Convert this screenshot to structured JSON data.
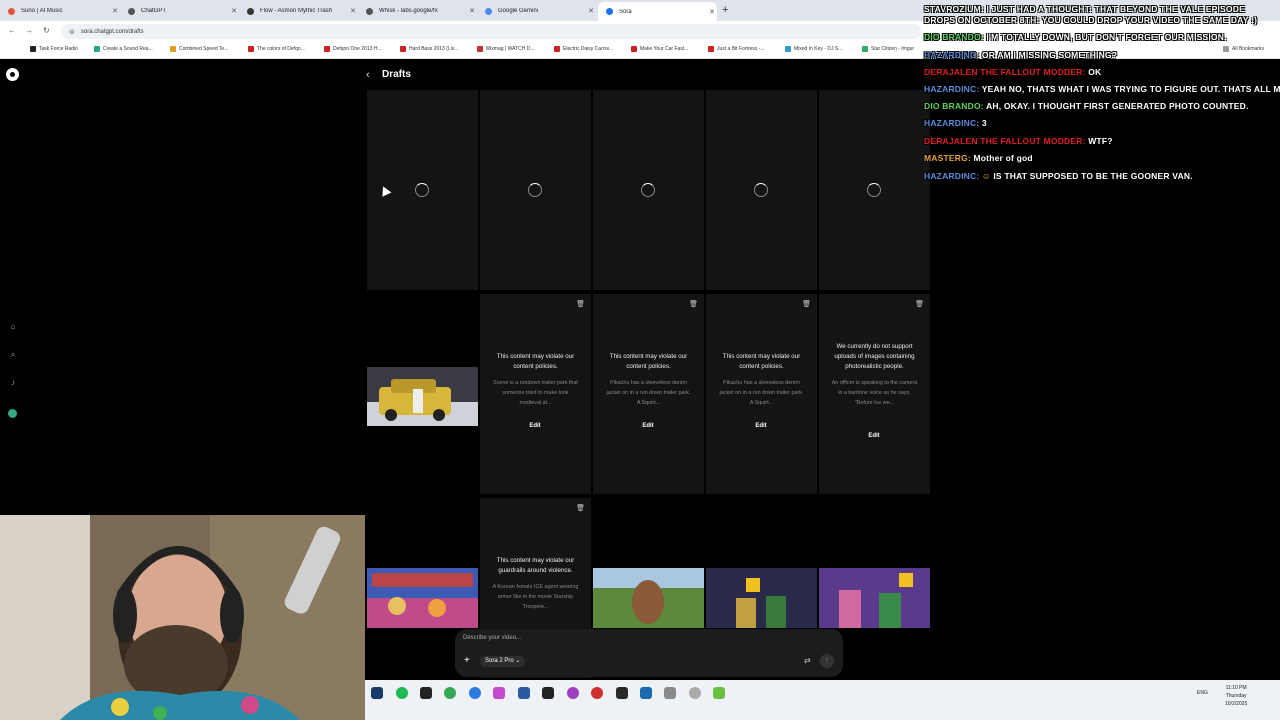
{
  "browser": {
    "tabs": [
      {
        "label": "Suno | AI Music",
        "color": "#e8553a"
      },
      {
        "label": "ChatGPT",
        "color": "#555555"
      },
      {
        "label": "Flow - Asmon Mythic Trash",
        "color": "#333333"
      },
      {
        "label": "Whisk - labs.google/fx",
        "color": "#555555"
      },
      {
        "label": "Google Gemini",
        "color": "#4a8af4"
      },
      {
        "label": "Sora",
        "color": "#1a73e8"
      }
    ],
    "url": "sora.chatgpt.com/drafts",
    "bookmarks": [
      "Task Force Radio",
      "Create a Sound Rea...",
      "Combined Speed Te...",
      "The colors of Defqo...",
      "Defqon One 2013 H...",
      "Hard Bass 2013 (Liv...",
      "Mixmag | WATCH D...",
      "Electric Daisy Carniv...",
      "Make Your Car Fast...",
      "Just a Bit Fortress -...",
      "Mixed In Key - DJ S...",
      "Star Citizen - Imgur"
    ],
    "all_bookmarks": "All Bookmarks"
  },
  "app": {
    "page_title": "Drafts",
    "cards_row2": [
      {
        "type": "thumb"
      },
      {
        "type": "error",
        "head": "This content may violate our content policies.",
        "desc": "Scene is a rundown trailer park that someone tried to make look medieval at..."
      },
      {
        "type": "error",
        "head": "This content may violate our content policies.",
        "desc": "Pikachu has a sleeveless denim jacket on in a run down trailer park. A Squirt..."
      },
      {
        "type": "error",
        "head": "This content may violate our content policies.",
        "desc": "Pikachu has a sleeveless denim jacket on in a run down trailer park. A Squirt..."
      },
      {
        "type": "error",
        "head": "We currently do not support uploads of images containing photorealistic people.",
        "desc": "An officer is speaking to the camera in a baritone voice as he says, \"Before Ice we..."
      }
    ],
    "card_row3": {
      "head": "This content may violate our guardrails around violence.",
      "desc": "A Korean female ICE agent wearing armor like in the movie Starship Troopers..."
    },
    "edit_label": "Edit",
    "prompt_placeholder": "Describe your video...",
    "model_label": "Sora 2 Pro"
  },
  "chat": [
    {
      "user": "Stavrozium:",
      "color": "#ffffff",
      "text": "I just had a thought: That beyond the vale episode drops on October 8th: you could drop your video the same day :)"
    },
    {
      "user": "Dio Brando:",
      "color": "#5fd35f",
      "text": "I'm totally down, but don't forget our mission."
    },
    {
      "user": "Hazardinc:",
      "color": "#5b8bd9",
      "text": "or am I missing something?"
    },
    {
      "user": "Derajalen The Fallout Modder:",
      "color": "#e02020",
      "text": "ok"
    },
    {
      "user": "Hazardinc:",
      "color": "#5b8bd9",
      "text": "yeah no, thats what I was trying to figure out. thats all man"
    },
    {
      "user": "Dio Brando:",
      "color": "#5fd35f",
      "text": "Ah, okay. I thought first generated photo counted."
    },
    {
      "user": "Hazardinc:",
      "color": "#5b8bd9",
      "text": "3"
    },
    {
      "user": "Derajalen The Fallout Modder:",
      "color": "#e02020",
      "text": "wtf?"
    },
    {
      "user": "MasterG:",
      "color": "#e8a040",
      "text": "Mother of god"
    },
    {
      "user": "Hazardinc:",
      "color": "#5b8bd9",
      "text": "is that supposed to be the gooner van."
    }
  ],
  "system": {
    "lang": "ENG",
    "time": "11:10 PM",
    "day": "Thursday",
    "date": "10/2/2025"
  }
}
